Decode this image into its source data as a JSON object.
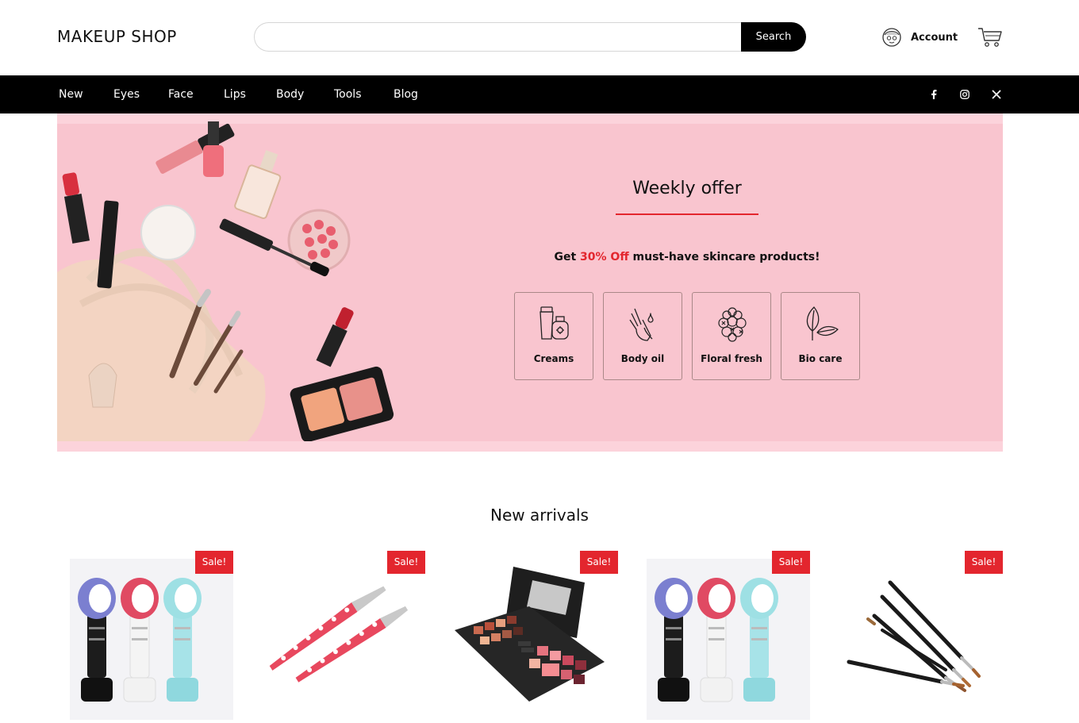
{
  "header": {
    "logo": "MAKEUP SHOP",
    "search_placeholder": "",
    "search_button": "Search",
    "account_label": "Account"
  },
  "nav": {
    "items": [
      "New",
      "Eyes",
      "Face",
      "Lips",
      "Body",
      "Tools",
      "Blog"
    ],
    "social": [
      "facebook-icon",
      "instagram-icon",
      "x-icon"
    ]
  },
  "hero": {
    "title": "Weekly offer",
    "text_before": "Get ",
    "text_highlight": "30% Off",
    "text_after": " must-have skincare products!",
    "categories": [
      {
        "label": "Creams",
        "icon": "cream-bottle-icon"
      },
      {
        "label": "Body oil",
        "icon": "hands-oil-icon"
      },
      {
        "label": "Floral fresh",
        "icon": "flower-icon"
      },
      {
        "label": "Bio care",
        "icon": "leaf-icon"
      }
    ]
  },
  "arrivals": {
    "title": "New arrivals",
    "products": [
      {
        "badge": "Sale!",
        "image": "eyelash-fan-dryers"
      },
      {
        "badge": "Sale!",
        "image": "polka-dot-tweezers"
      },
      {
        "badge": "Sale!",
        "image": "eyeshadow-palette"
      },
      {
        "badge": "Sale!",
        "image": "eyelash-fan-dryers"
      },
      {
        "badge": "Sale!",
        "image": "makeup-brushes"
      }
    ]
  },
  "colors": {
    "accent": "#e3262e",
    "nav_bg": "#000000",
    "hero_bg": "#f9c5cf"
  }
}
